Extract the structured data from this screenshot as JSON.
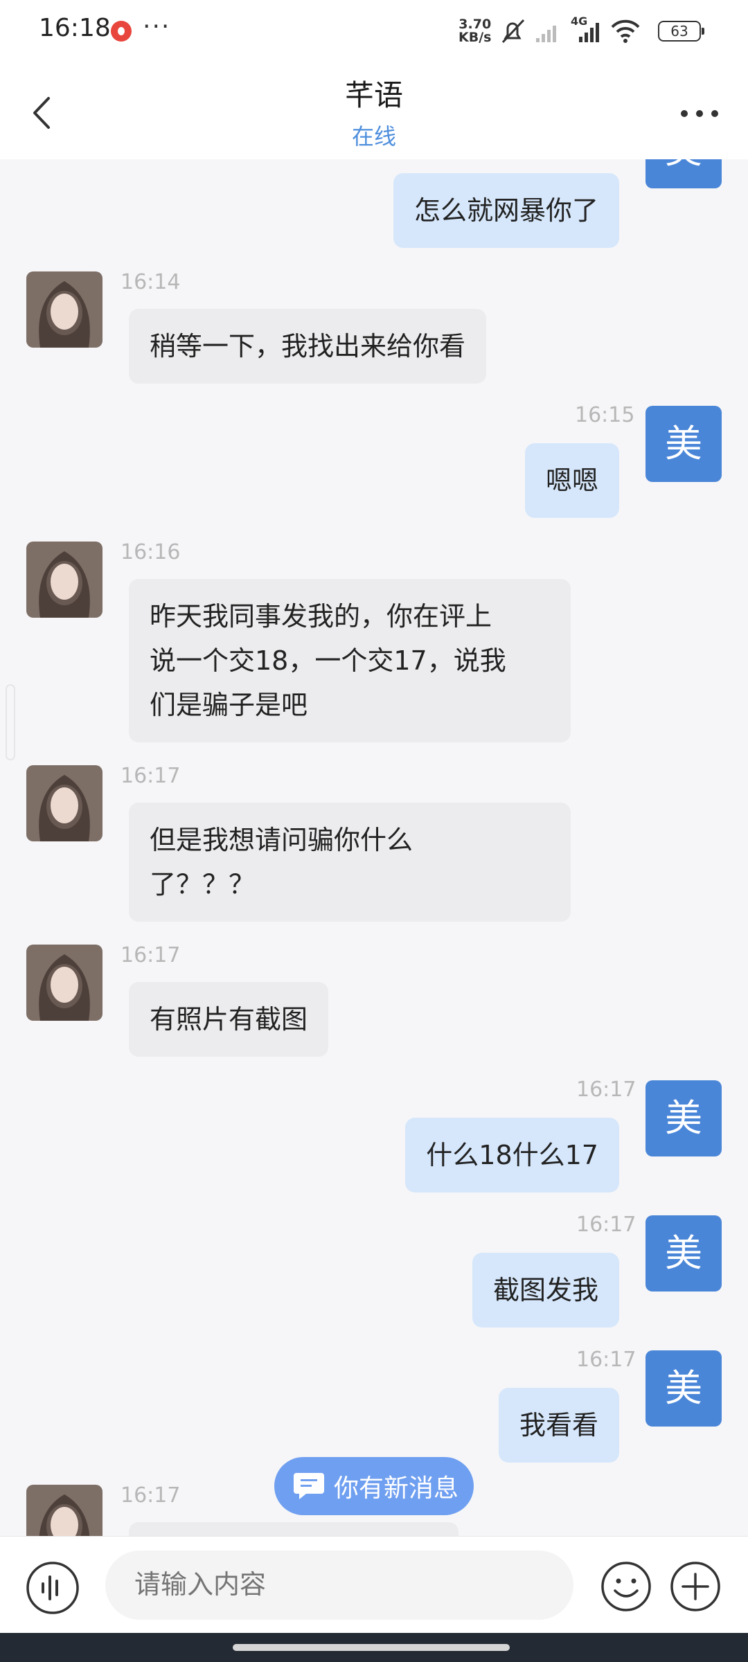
{
  "status_bar": {
    "time": "16:18",
    "more": "···",
    "speed_value": "3.70",
    "speed_unit": "KB/s",
    "network": "4G",
    "battery": "63"
  },
  "header": {
    "title": "芊语",
    "subtitle": "在线"
  },
  "me_avatar": "美",
  "messages": [
    {
      "sender": "me",
      "time": "",
      "lines": [
        "怎么就网暴你了"
      ]
    },
    {
      "sender": "her",
      "time": "16:14",
      "lines": [
        "稍等一下，我找出来给你看"
      ]
    },
    {
      "sender": "me",
      "time": "16:15",
      "lines": [
        "嗯嗯"
      ]
    },
    {
      "sender": "her",
      "time": "16:16",
      "lines": [
        "昨天我同事发我的，你在评上",
        "说一个交18，一个交17，说我",
        "们是骗子是吧"
      ]
    },
    {
      "sender": "her",
      "time": "16:17",
      "lines": [
        "但是我想请问骗你什么",
        "了？？？"
      ]
    },
    {
      "sender": "her",
      "time": "16:17",
      "lines": [
        "有照片有截图"
      ]
    },
    {
      "sender": "me",
      "time": "16:17",
      "lines": [
        "什么18什么17"
      ]
    },
    {
      "sender": "me",
      "time": "16:17",
      "lines": [
        "截图发我"
      ]
    },
    {
      "sender": "me",
      "time": "16:17",
      "lines": [
        "我看看"
      ]
    },
    {
      "sender": "her",
      "time": "16:17",
      "lines": [
        ""
      ]
    }
  ],
  "new_message_pill": "你有新消息",
  "input": {
    "placeholder": "请输入内容"
  },
  "icons": {
    "back": "chevron-left-icon",
    "more": "more-dots-icon",
    "voice": "voice-icon",
    "emoji": "emoji-icon",
    "plus": "plus-icon",
    "new_message": "chat-bubble-icon"
  },
  "colors": {
    "accent": "#4f8fdd",
    "my_avatar": "#4a86d8",
    "my_bubble": "#d6e7fb",
    "her_bubble": "#ececee",
    "pill": "#6f9ff0"
  }
}
